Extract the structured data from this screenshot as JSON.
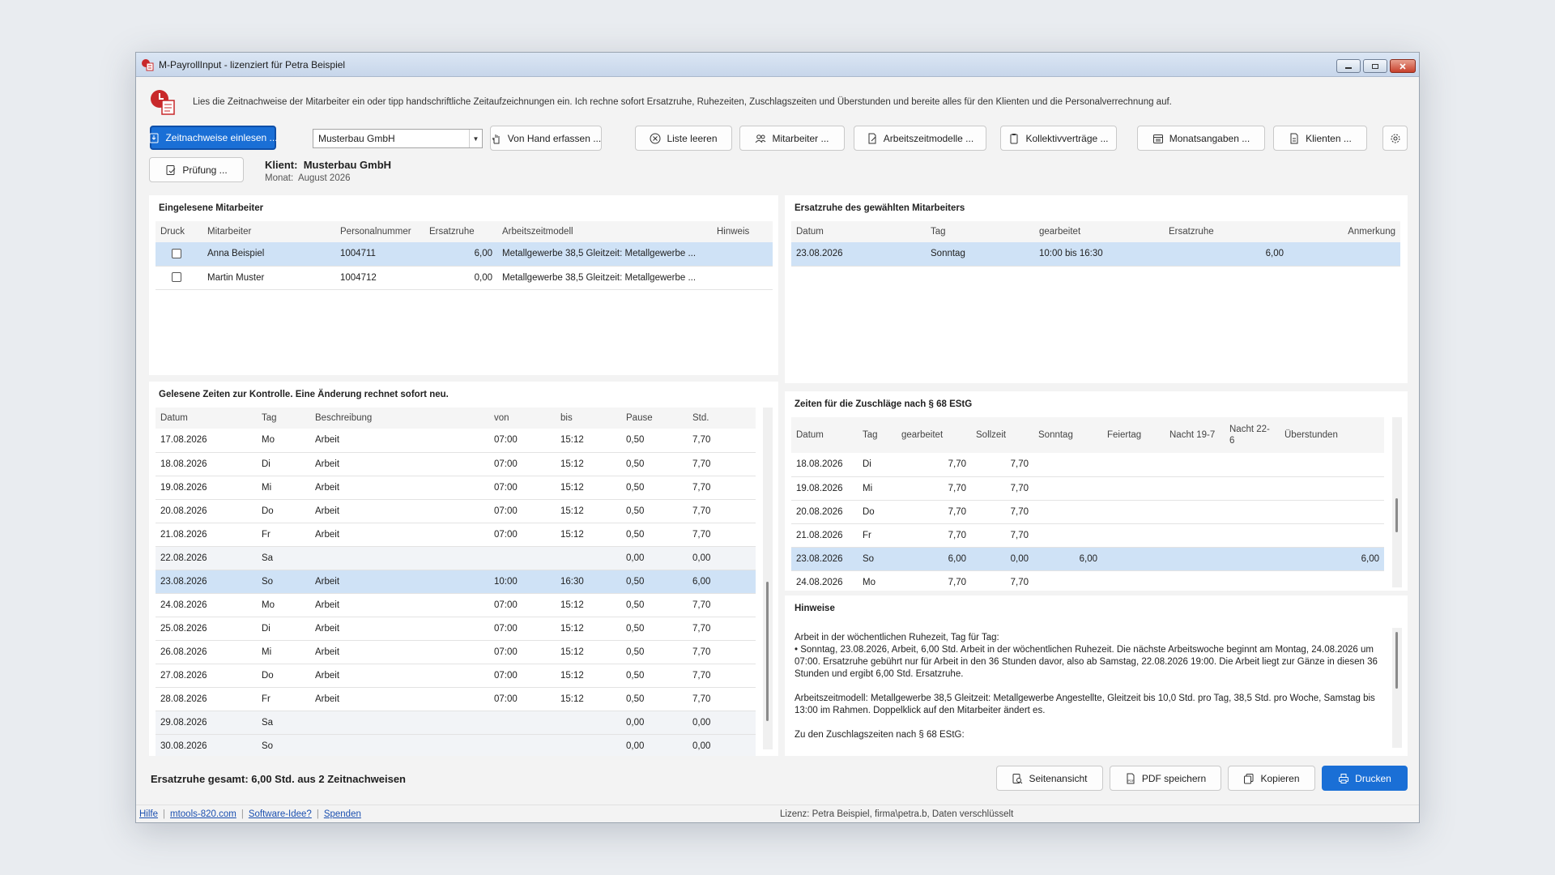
{
  "window": {
    "title": "M-PayrollInput - lizenziert für Petra Beispiel"
  },
  "intro": {
    "text": "Lies die Zeitnachweise der Mitarbeiter ein oder tipp handschriftliche Zeitaufzeichnungen ein. Ich rechne sofort Ersatzruhe, Ruhezeiten, Zuschlagszeiten und Überstunden und bereite alles für den Klienten und die Personalverrechnung auf."
  },
  "toolbar": {
    "import_label": "Zeitnachweise einlesen ...",
    "client_select": "Musterbau GmbH",
    "manual_label": "Von Hand erfassen ...",
    "clear_label": "Liste leeren",
    "employees_label": "Mitarbeiter ...",
    "models_label": "Arbeitszeitmodelle ...",
    "agreements_label": "Kollektivverträge ...",
    "monthly_label": "Monatsangaben ...",
    "clients_label": "Klienten ...",
    "check_label": "Prüfung ..."
  },
  "client": {
    "label": "Klient:",
    "name": "Musterbau GmbH",
    "month_label": "Monat:",
    "month": "August 2026"
  },
  "employees_panel": {
    "title": "Eingelesene Mitarbeiter",
    "headers": [
      "Druck",
      "Mitarbeiter",
      "Personalnummer",
      "Ersatzruhe",
      "Arbeitszeitmodell",
      "Hinweis"
    ],
    "rows": [
      {
        "name": "Anna Beispiel",
        "number": "1004711",
        "rest": "6,00",
        "model": "Metallgewerbe 38,5 Gleitzeit: Metallgewerbe ...",
        "note": ""
      },
      {
        "name": "Martin Muster",
        "number": "1004712",
        "rest": "0,00",
        "model": "Metallgewerbe 38,5 Gleitzeit: Metallgewerbe ...",
        "note": ""
      }
    ]
  },
  "rest_panel": {
    "title": "Ersatzruhe des gewählten Mitarbeiters",
    "headers": [
      "Datum",
      "Tag",
      "gearbeitet",
      "Ersatzruhe",
      "Anmerkung"
    ],
    "rows": [
      {
        "date": "23.08.2026",
        "day": "Sonntag",
        "worked": "10:00 bis 16:30",
        "rest": "6,00",
        "note": ""
      }
    ]
  },
  "times_panel": {
    "title": "Gelesene Zeiten zur Kontrolle. Eine Änderung rechnet sofort neu.",
    "headers": [
      "Datum",
      "Tag",
      "Beschreibung",
      "von",
      "bis",
      "Pause",
      "Std."
    ],
    "rows": [
      {
        "date": "17.08.2026",
        "day": "Mo",
        "desc": "Arbeit",
        "from": "07:00",
        "to": "15:12",
        "pause": "0,50",
        "hours": "7,70"
      },
      {
        "date": "18.08.2026",
        "day": "Di",
        "desc": "Arbeit",
        "from": "07:00",
        "to": "15:12",
        "pause": "0,50",
        "hours": "7,70"
      },
      {
        "date": "19.08.2026",
        "day": "Mi",
        "desc": "Arbeit",
        "from": "07:00",
        "to": "15:12",
        "pause": "0,50",
        "hours": "7,70"
      },
      {
        "date": "20.08.2026",
        "day": "Do",
        "desc": "Arbeit",
        "from": "07:00",
        "to": "15:12",
        "pause": "0,50",
        "hours": "7,70"
      },
      {
        "date": "21.08.2026",
        "day": "Fr",
        "desc": "Arbeit",
        "from": "07:00",
        "to": "15:12",
        "pause": "0,50",
        "hours": "7,70"
      },
      {
        "date": "22.08.2026",
        "day": "Sa",
        "desc": "",
        "from": "",
        "to": "",
        "pause": "0,00",
        "hours": "0,00"
      },
      {
        "date": "23.08.2026",
        "day": "So",
        "desc": "Arbeit",
        "from": "10:00",
        "to": "16:30",
        "pause": "0,50",
        "hours": "6,00"
      },
      {
        "date": "24.08.2026",
        "day": "Mo",
        "desc": "Arbeit",
        "from": "07:00",
        "to": "15:12",
        "pause": "0,50",
        "hours": "7,70"
      },
      {
        "date": "25.08.2026",
        "day": "Di",
        "desc": "Arbeit",
        "from": "07:00",
        "to": "15:12",
        "pause": "0,50",
        "hours": "7,70"
      },
      {
        "date": "26.08.2026",
        "day": "Mi",
        "desc": "Arbeit",
        "from": "07:00",
        "to": "15:12",
        "pause": "0,50",
        "hours": "7,70"
      },
      {
        "date": "27.08.2026",
        "day": "Do",
        "desc": "Arbeit",
        "from": "07:00",
        "to": "15:12",
        "pause": "0,50",
        "hours": "7,70"
      },
      {
        "date": "28.08.2026",
        "day": "Fr",
        "desc": "Arbeit",
        "from": "07:00",
        "to": "15:12",
        "pause": "0,50",
        "hours": "7,70"
      },
      {
        "date": "29.08.2026",
        "day": "Sa",
        "desc": "",
        "from": "",
        "to": "",
        "pause": "0,00",
        "hours": "0,00"
      },
      {
        "date": "30.08.2026",
        "day": "So",
        "desc": "",
        "from": "",
        "to": "",
        "pause": "0,00",
        "hours": "0,00"
      }
    ]
  },
  "surcharge_panel": {
    "title": "Zeiten für die Zuschläge nach § 68 EStG",
    "headers": [
      "Datum",
      "Tag",
      "gearbeitet",
      "Sollzeit",
      "Sonntag",
      "Feiertag",
      "Nacht 19-7",
      "Nacht 22-6",
      "Überstunden"
    ],
    "rows": [
      {
        "date": "18.08.2026",
        "day": "Di",
        "worked": "7,70",
        "target": "7,70",
        "sunday": "",
        "holiday": "",
        "n1": "",
        "n2": "",
        "over": ""
      },
      {
        "date": "19.08.2026",
        "day": "Mi",
        "worked": "7,70",
        "target": "7,70",
        "sunday": "",
        "holiday": "",
        "n1": "",
        "n2": "",
        "over": ""
      },
      {
        "date": "20.08.2026",
        "day": "Do",
        "worked": "7,70",
        "target": "7,70",
        "sunday": "",
        "holiday": "",
        "n1": "",
        "n2": "",
        "over": ""
      },
      {
        "date": "21.08.2026",
        "day": "Fr",
        "worked": "7,70",
        "target": "7,70",
        "sunday": "",
        "holiday": "",
        "n1": "",
        "n2": "",
        "over": ""
      },
      {
        "date": "23.08.2026",
        "day": "So",
        "worked": "6,00",
        "target": "0,00",
        "sunday": "6,00",
        "holiday": "",
        "n1": "",
        "n2": "",
        "over": "6,00"
      },
      {
        "date": "24.08.2026",
        "day": "Mo",
        "worked": "7,70",
        "target": "7,70",
        "sunday": "",
        "holiday": "",
        "n1": "",
        "n2": "",
        "over": ""
      }
    ]
  },
  "notes_panel": {
    "title": "Hinweise",
    "paragraphs": [
      "Arbeit in der wöchentlichen Ruhezeit, Tag für Tag:\n• Sonntag, 23.08.2026, Arbeit, 6,00 Std. Arbeit in der wöchentlichen Ruhezeit. Die nächste Arbeitswoche beginnt am Montag, 24.08.2026 um 07:00. Ersatzruhe gebührt nur für Arbeit in den 36 Stunden davor, also ab Samstag, 22.08.2026 19:00. Die Arbeit liegt zur Gänze in diesen 36 Stunden und ergibt 6,00 Std. Ersatzruhe.",
      "Arbeitszeitmodell: Metallgewerbe 38,5 Gleitzeit: Metallgewerbe Angestellte, Gleitzeit bis 10,0 Std. pro Tag, 38,5 Std. pro Woche, Samstag bis 13:00 im Rahmen. Doppelklick auf den Mitarbeiter ändert es.",
      "Zu den Zuschlagszeiten nach § 68 EStG:"
    ]
  },
  "summary": {
    "text": "Ersatzruhe gesamt: 6,00 Std. aus 2 Zeitnachweisen"
  },
  "actions": {
    "preview": "Seitenansicht",
    "pdf": "PDF speichern",
    "copy": "Kopieren",
    "print": "Drucken"
  },
  "statusbar": {
    "help": "Hilfe",
    "site": "mtools-820.com",
    "idea": "Software-Idee?",
    "donate": "Spenden",
    "license": "Lizenz: Petra Beispiel, firma\\petra.b, Daten verschlüsselt"
  },
  "colors": {
    "accent": "#1a6fd6",
    "selection": "#cfe2f6"
  }
}
